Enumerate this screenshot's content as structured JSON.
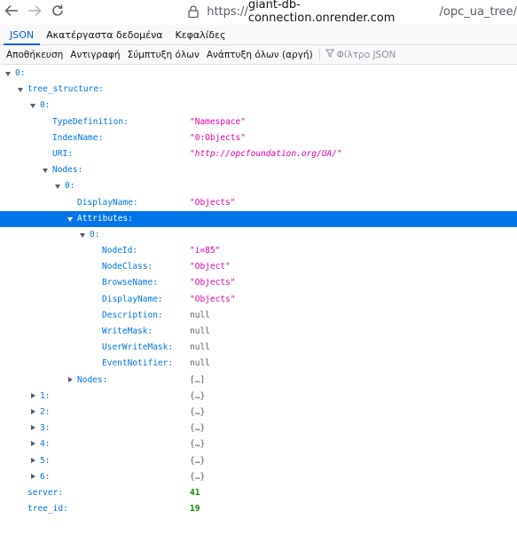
{
  "browser": {
    "url_prefix": "https://",
    "url_host": "giant-db-connection.onrender.com",
    "url_path": "/opc_ua_tree/"
  },
  "viewer": {
    "tabs": [
      "JSON",
      "Ακατέργαστα δεδομένα",
      "Κεφαλίδες"
    ],
    "toolbar": {
      "save": "Αποθήκευση",
      "copy": "Αντιγραφή",
      "collapse_all": "Σύμπτυξη όλων",
      "expand_all": "Ανάπτυξη όλων (αργή)",
      "filter_placeholder": "Φίλτρο JSON"
    }
  },
  "tree": [
    {
      "key": "0:",
      "depth": 0,
      "toggle": "open"
    },
    {
      "key": "tree_structure:",
      "depth": 1,
      "toggle": "open"
    },
    {
      "key": "0:",
      "depth": 2,
      "toggle": "open"
    },
    {
      "key": "TypeDefinition:",
      "depth": 3,
      "value": "\"Namespace\"",
      "vtype": "str"
    },
    {
      "key": "IndexName:",
      "depth": 3,
      "value": "\"0:Objects\"",
      "vtype": "str"
    },
    {
      "key": "URI:",
      "depth": 3,
      "value": "\"http://opcfoundation.org/UA/\"",
      "vtype": "url"
    },
    {
      "key": "Nodes:",
      "depth": 3,
      "toggle": "open"
    },
    {
      "key": "0:",
      "depth": 4,
      "toggle": "open"
    },
    {
      "key": "DisplayName:",
      "depth": 5,
      "value": "\"Objects\"",
      "vtype": "str"
    },
    {
      "key": "Attributes:",
      "depth": 5,
      "toggle": "open",
      "selected": true
    },
    {
      "key": "0:",
      "depth": 6,
      "toggle": "open"
    },
    {
      "key": "NodeId:",
      "depth": 7,
      "value": "\"i=85\"",
      "vtype": "str"
    },
    {
      "key": "NodeClass:",
      "depth": 7,
      "value": "\"Object\"",
      "vtype": "str"
    },
    {
      "key": "BrowseName:",
      "depth": 7,
      "value": "\"Objects\"",
      "vtype": "str"
    },
    {
      "key": "DisplayName:",
      "depth": 7,
      "value": "\"Objects\"",
      "vtype": "str"
    },
    {
      "key": "Description:",
      "depth": 7,
      "value": "null",
      "vtype": "null"
    },
    {
      "key": "WriteMask:",
      "depth": 7,
      "value": "null",
      "vtype": "null"
    },
    {
      "key": "UserWriteMask:",
      "depth": 7,
      "value": "null",
      "vtype": "null"
    },
    {
      "key": "EventNotifier:",
      "depth": 7,
      "value": "null",
      "vtype": "null"
    },
    {
      "key": "Nodes:",
      "depth": 5,
      "toggle": "closed",
      "value": "[…]",
      "vtype": "arr"
    },
    {
      "key": "1:",
      "depth": 2,
      "toggle": "closed",
      "value": "{…}",
      "vtype": "obj"
    },
    {
      "key": "2:",
      "depth": 2,
      "toggle": "closed",
      "value": "{…}",
      "vtype": "obj"
    },
    {
      "key": "3:",
      "depth": 2,
      "toggle": "closed",
      "value": "{…}",
      "vtype": "obj"
    },
    {
      "key": "4:",
      "depth": 2,
      "toggle": "closed",
      "value": "{…}",
      "vtype": "obj"
    },
    {
      "key": "5:",
      "depth": 2,
      "toggle": "closed",
      "value": "{…}",
      "vtype": "obj"
    },
    {
      "key": "6:",
      "depth": 2,
      "toggle": "closed",
      "value": "{…}",
      "vtype": "obj"
    },
    {
      "key": "server:",
      "depth": 1,
      "value": "41",
      "vtype": "num"
    },
    {
      "key": "tree_id:",
      "depth": 1,
      "value": "19",
      "vtype": "num"
    }
  ]
}
